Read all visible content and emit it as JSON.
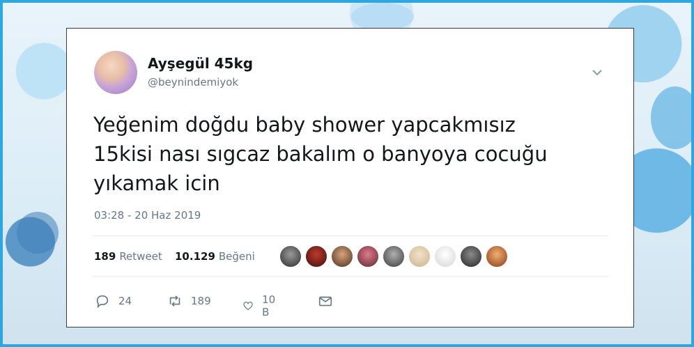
{
  "tweet": {
    "display_name": "Ayşegül 45kg",
    "handle": "@beynindemiyok",
    "text_lines": [
      "Yeğenim doğdu baby shower yapcakmısız",
      "15kisi nası sıgcaz bakalım o banyoya cocuğu",
      "yıkamak icin"
    ],
    "timestamp": "03:28 - 20 Haz 2019",
    "retweets_count": "189",
    "retweets_label": "Retweet",
    "likes_count": "10.129",
    "likes_label": "Beğeni",
    "actions": {
      "reply_count": "24",
      "retweet_count": "189",
      "like_count": "10 B"
    }
  },
  "icons": {
    "caret": "chevron-down-icon",
    "reply": "reply-icon",
    "retweet": "retweet-icon",
    "like": "heart-icon",
    "dm": "mail-icon"
  },
  "colors": {
    "frame_border": "#2ea6e0",
    "text_primary": "#14171a",
    "text_secondary": "#657786"
  }
}
